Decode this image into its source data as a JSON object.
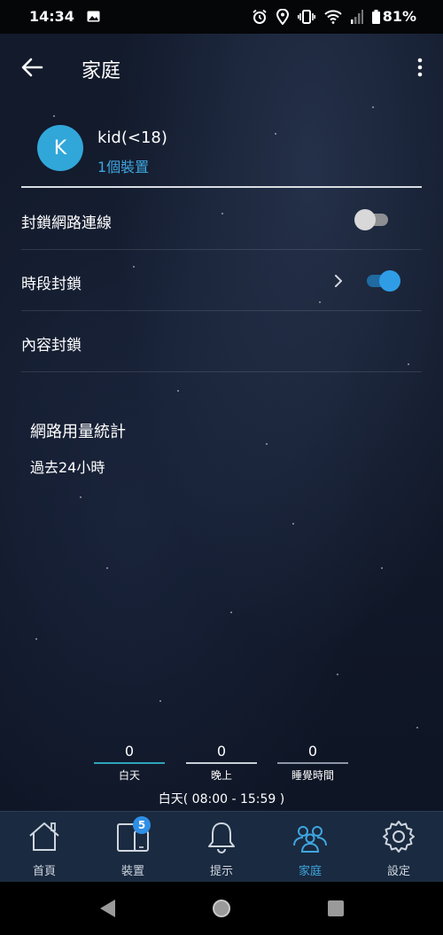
{
  "status_bar": {
    "time": "14:34",
    "battery": "81%",
    "icons": [
      "image-icon",
      "alarm-icon",
      "location-icon",
      "vibrate-icon",
      "wifi-icon",
      "signal-icon",
      "battery-icon"
    ]
  },
  "app_bar": {
    "title": "家庭",
    "back_icon": "back-arrow-icon",
    "more_icon": "more-vert-icon"
  },
  "profile": {
    "initial": "K",
    "name": "kid(<18)",
    "devices": "1個裝置",
    "avatar_color": "#31a7d9"
  },
  "settings": [
    {
      "label": "封鎖網路連線",
      "toggle": "off"
    },
    {
      "label": "時段封鎖",
      "toggle": "on",
      "has_chevron": true
    },
    {
      "label": "內容封鎖"
    }
  ],
  "stats": {
    "title": "網路用量統計",
    "range": "過去24小時",
    "items": [
      {
        "value": "0",
        "label": "白天",
        "color": "#2fa4b8"
      },
      {
        "value": "0",
        "label": "晚上",
        "color": "#c9cfd6"
      },
      {
        "value": "0",
        "label": "睡覺時間",
        "color": "#8a96a8"
      }
    ],
    "time_range": "白天( 08:00 - 15:59 )"
  },
  "bottom_nav": {
    "items": [
      {
        "label": "首頁",
        "icon": "home-icon"
      },
      {
        "label": "裝置",
        "icon": "devices-icon",
        "badge": "5"
      },
      {
        "label": "提示",
        "icon": "bell-icon"
      },
      {
        "label": "家庭",
        "icon": "family-icon",
        "active": true
      },
      {
        "label": "設定",
        "icon": "gear-icon"
      }
    ]
  },
  "system_nav": [
    "back-triangle-icon",
    "home-circle-icon",
    "recents-square-icon"
  ],
  "colors": {
    "accent": "#3ea6e0",
    "toggle_on": "#2f9de6",
    "toggle_off": "#d8d8d8",
    "nav_background": "#1a2a40"
  }
}
